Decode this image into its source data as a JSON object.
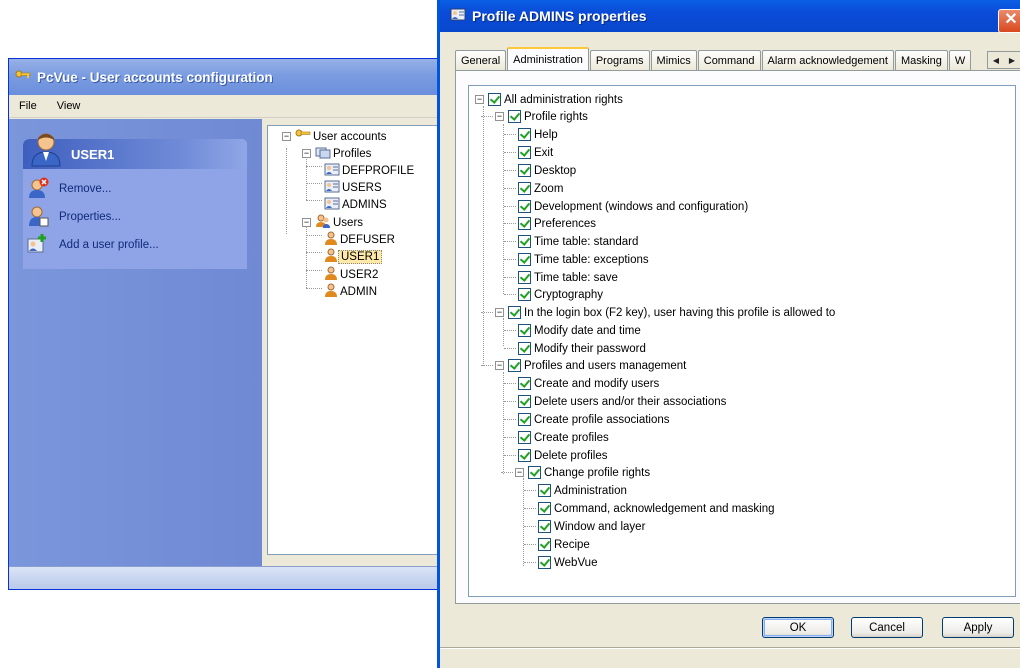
{
  "back_window": {
    "title": "PcVue - User accounts configuration",
    "menu": [
      "File",
      "View"
    ],
    "task_panel": {
      "header": "USER1",
      "items": [
        {
          "label": "Remove...",
          "icon": "remove-user-icon"
        },
        {
          "label": "Properties...",
          "icon": "user-properties-icon"
        },
        {
          "label": "Add a user profile...",
          "icon": "add-profile-icon"
        }
      ]
    },
    "tree": {
      "root": "User accounts",
      "profiles_label": "Profiles",
      "profiles": [
        "DEFPROFILE",
        "USERS",
        "ADMINS"
      ],
      "users_label": "Users",
      "users": [
        "DEFUSER",
        "USER1",
        "USER2",
        "ADMIN"
      ],
      "selected": "USER1"
    }
  },
  "dialog": {
    "title": "Profile ADMINS properties",
    "tabs": [
      "General",
      "Administration",
      "Programs",
      "Mimics",
      "Command",
      "Alarm acknowledgement",
      "Masking",
      "W"
    ],
    "active_tab": "Administration",
    "rights": {
      "root": "All administration rights",
      "profile_rights": {
        "label": "Profile rights",
        "items": [
          "Help",
          "Exit",
          "Desktop",
          "Zoom",
          "Development (windows and configuration)",
          "Preferences",
          "Time table: standard",
          "Time table: exceptions",
          "Time table: save",
          "Cryptography"
        ]
      },
      "login_box": {
        "label": "In the login box (F2 key), user having this profile is allowed to",
        "items": [
          "Modify date and time",
          "Modify their password"
        ]
      },
      "management": {
        "label": "Profiles and users management",
        "items": [
          "Create and modify users",
          "Delete users and/or their associations",
          "Create profile associations",
          "Create profiles",
          "Delete profiles"
        ],
        "change_rights": {
          "label": "Change profile rights",
          "items": [
            "Administration",
            "Command, acknowledgement and masking",
            "Window and layer",
            "Recipe",
            "WebVue"
          ]
        }
      }
    },
    "buttons": {
      "ok": "OK",
      "cancel": "Cancel",
      "apply": "Apply"
    }
  },
  "colors": {
    "xp_title_active": "#0a4bd8",
    "xp_title_inactive": "#7a9ce0",
    "task_pane": "#7b96db",
    "check": "#21a121"
  }
}
